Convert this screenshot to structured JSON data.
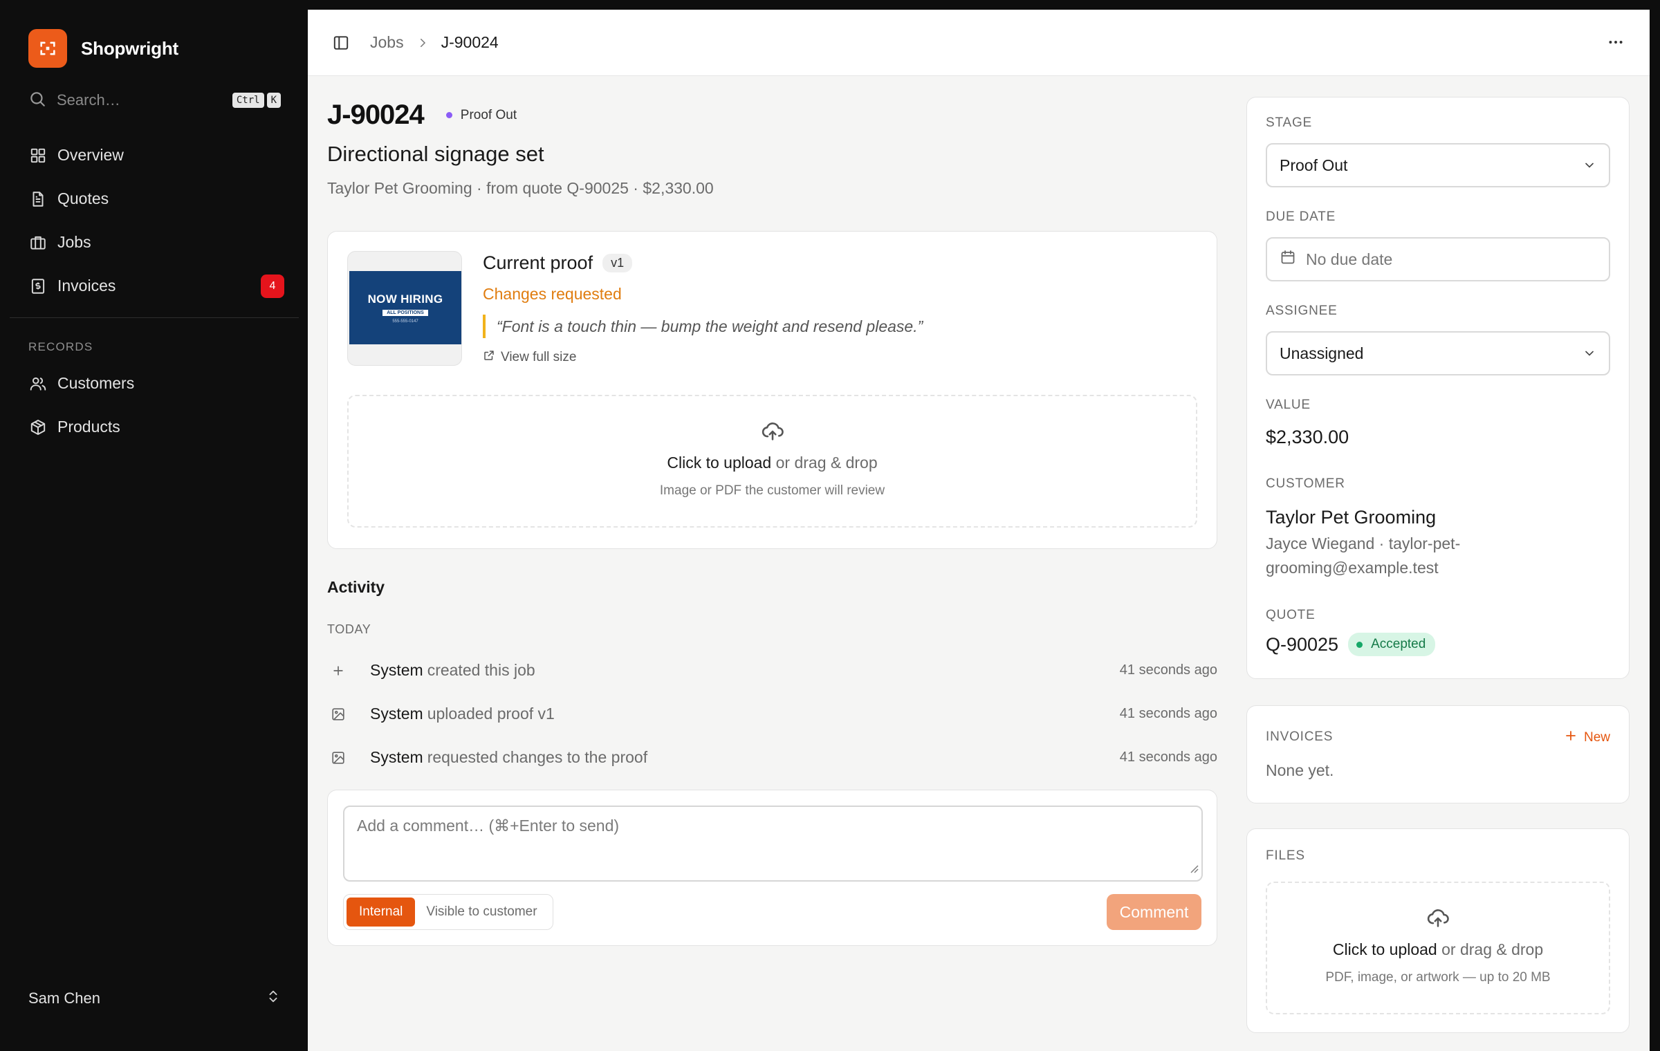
{
  "app": {
    "name": "Shopwright"
  },
  "sidebar": {
    "search_placeholder": "Search…",
    "shortcut": [
      "Ctrl",
      "K"
    ],
    "items": [
      {
        "label": "Overview",
        "icon": "grid-icon"
      },
      {
        "label": "Quotes",
        "icon": "document-icon"
      },
      {
        "label": "Jobs",
        "icon": "briefcase-icon"
      },
      {
        "label": "Invoices",
        "icon": "invoice-icon",
        "badge": "4"
      }
    ],
    "records_label": "RECORDS",
    "records": [
      {
        "label": "Customers",
        "icon": "users-icon"
      },
      {
        "label": "Products",
        "icon": "box-icon"
      }
    ],
    "user": "Sam Chen"
  },
  "breadcrumb": {
    "parent": "Jobs",
    "current": "J-90024"
  },
  "job": {
    "id": "J-90024",
    "status": "Proof Out",
    "title": "Directional signage set",
    "subtitle": "Taylor Pet Grooming · from quote Q-90025 · $2,330.00"
  },
  "proof": {
    "title": "Current proof",
    "version": "v1",
    "status": "Changes requested",
    "feedback": "“Font is a touch thin — bump the weight and resend please.”",
    "view_full": "View full size",
    "thumbnail": {
      "headline": "NOW HIRING",
      "tag": "ALL POSITIONS",
      "phone": "555-555-0147"
    },
    "upload_action": "Click to upload",
    "upload_rest": "or drag & drop",
    "upload_hint": "Image or PDF the customer will review"
  },
  "activity": {
    "title": "Activity",
    "group": "TODAY",
    "items": [
      {
        "actor": "System",
        "text": "created this job",
        "time": "41 seconds ago",
        "icon": "plus-icon"
      },
      {
        "actor": "System",
        "text": "uploaded proof v1",
        "time": "41 seconds ago",
        "icon": "image-icon"
      },
      {
        "actor": "System",
        "text": "requested changes to the proof",
        "time": "41 seconds ago",
        "icon": "image-icon"
      }
    ]
  },
  "comment": {
    "placeholder": "Add a comment… (⌘+Enter to send)",
    "visibility_internal": "Internal",
    "visibility_customer": "Visible to customer",
    "submit": "Comment"
  },
  "details": {
    "stage_label": "STAGE",
    "stage_value": "Proof Out",
    "due_label": "DUE DATE",
    "due_value": "No due date",
    "assignee_label": "ASSIGNEE",
    "assignee_value": "Unassigned",
    "value_label": "VALUE",
    "value": "$2,330.00",
    "customer_label": "CUSTOMER",
    "customer_name": "Taylor Pet Grooming",
    "customer_contact": "Jayce Wiegand · taylor-pet-grooming@example.test",
    "quote_label": "QUOTE",
    "quote_no": "Q-90025",
    "quote_status": "Accepted"
  },
  "invoices": {
    "label": "INVOICES",
    "new": "New",
    "empty": "None yet."
  },
  "files": {
    "label": "FILES",
    "upload_action": "Click to upload",
    "upload_rest": "or drag & drop",
    "upload_hint": "PDF, image, or artwork — up to 20 MB"
  },
  "colors": {
    "accent": "#e5560f",
    "brand": "#ec5b1a",
    "status_proof": "#8b5cf6",
    "warning": "#e07d10",
    "success": "#16a868"
  }
}
